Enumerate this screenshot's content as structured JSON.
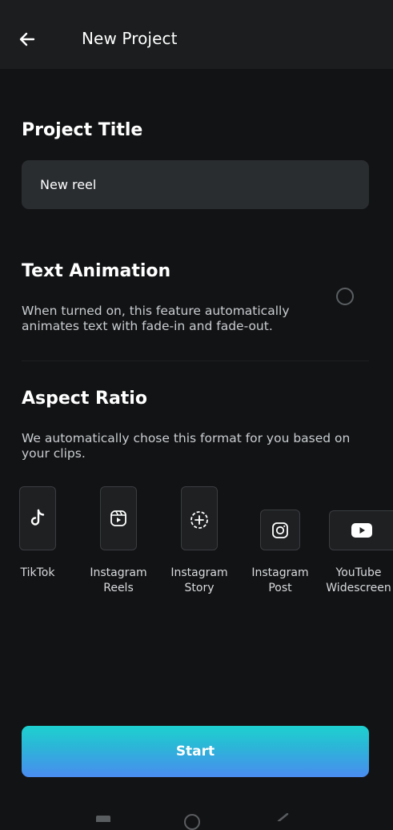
{
  "header": {
    "title": "New Project",
    "back_icon": "arrow-left-icon"
  },
  "project_title": {
    "heading": "Project Title",
    "value": "New reel"
  },
  "text_animation": {
    "heading": "Text Animation",
    "description": "When turned on, this feature automatically animates text with fade-in and fade-out.",
    "enabled": false
  },
  "aspect_ratio": {
    "heading": "Aspect Ratio",
    "description": "We automatically chose this format for you based on your clips.",
    "options": [
      {
        "label": "TikTok",
        "icon": "tiktok-icon"
      },
      {
        "label": "Instagram Reels",
        "icon": "instagram-reels-icon"
      },
      {
        "label": "Instagram Story",
        "icon": "instagram-story-icon"
      },
      {
        "label": "Instagram Post",
        "icon": "instagram-post-icon"
      },
      {
        "label": "YouTube Widescreen",
        "icon": "youtube-icon"
      }
    ]
  },
  "actions": {
    "start_label": "Start"
  },
  "colors": {
    "background": "#121314",
    "header_bg": "#1b1d1e",
    "input_bg": "#2a2d30",
    "accent_gradient_start": "#1dd1cf",
    "accent_gradient_end": "#4a8cf0"
  }
}
